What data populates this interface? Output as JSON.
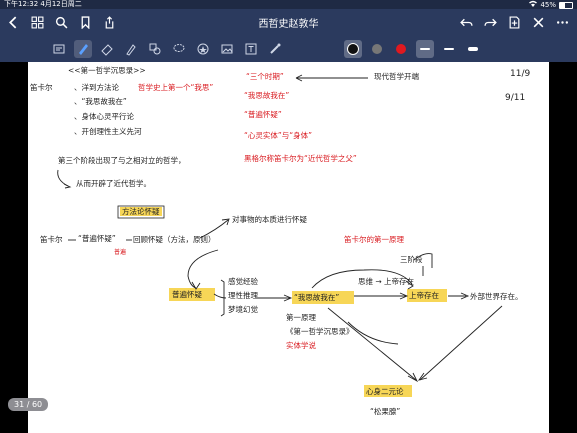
{
  "status_bar": {
    "time_date": "下午12:32  4月12日周二",
    "battery": "45%",
    "battery_level": 0.45
  },
  "nav": {
    "title": "西哲史赵敦华"
  },
  "page_indicator": "31 / 60",
  "notes": {
    "top_heading": "<<第一哲学沉思录>>",
    "left_topic": "笛卡尔",
    "left_points": [
      "、洋到方法论",
      "、“我思故我在”",
      "、身体心灵平行论",
      "、开创理性主义先河"
    ],
    "red_note_1": "哲学史上第一个“我思”",
    "red_list": [
      "“三个时期”",
      "“我思故我在”",
      "“普遍怀疑”",
      "“心灵实体”与“身体”"
    ],
    "red_extra": "黑格尔称笛卡尔为“近代哲学之父”",
    "right_note": "现代哲学开端",
    "dates": [
      "11/9",
      "9/11"
    ],
    "mid_line_1": "第三个阶段出现了与之相对立的哲学，",
    "mid_line_2": "从而开辟了近代哲学。",
    "boxed_label": "方法论怀疑",
    "center_left": "笛卡尔",
    "center_mid": "“普遍怀疑”",
    "center_mid2": "回顾怀疑（方法，原则）",
    "center_top": "对事物的本质进行怀疑",
    "red_small": "普遍",
    "highlight_1": "普遍怀疑",
    "side_list": [
      "感觉经验",
      "理性推理",
      "梦境幻觉"
    ],
    "highlight_2": "“我思故我在”",
    "red_top_right": "笛卡尔的第一原理",
    "sanjie": "三阶段",
    "chain_mid": "思维 → 上帝存在",
    "highlight_3": "上帝存在",
    "chain_end": "外部世界存在。",
    "bullets": [
      "第一原理",
      "《第一哲学沉思录》",
      "实体学说"
    ],
    "bottom_highlight": "心身二元论",
    "bottom_quote": "“松果腺”"
  }
}
